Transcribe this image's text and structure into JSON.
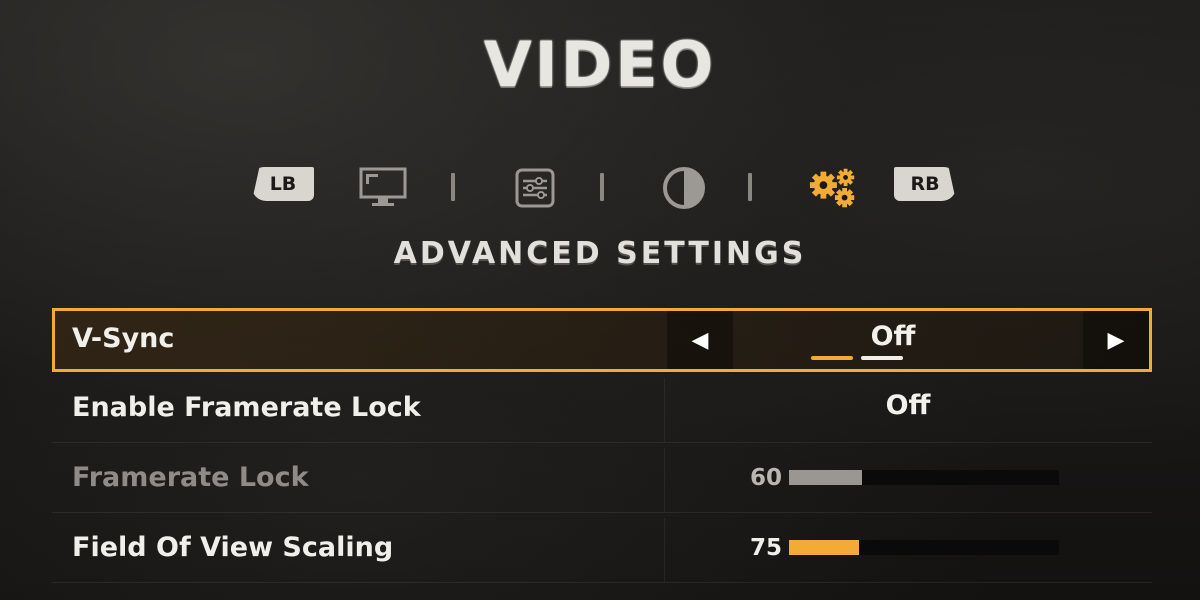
{
  "header": {
    "title": "VIDEO"
  },
  "tabs": {
    "left_bumper": "LB",
    "right_bumper": "RB",
    "items": [
      {
        "icon": "monitor-icon",
        "active": false
      },
      {
        "icon": "sliders-icon",
        "active": false
      },
      {
        "icon": "contrast-icon",
        "active": false
      },
      {
        "icon": "gears-icon",
        "active": true
      }
    ]
  },
  "section": {
    "title": "ADVANCED SETTINGS"
  },
  "colors": {
    "accent": "#f2ab34",
    "inactive_fill": "#9a9792",
    "text": "#f1efea"
  },
  "settings": [
    {
      "label": "V-Sync",
      "value": "Off",
      "type": "selector",
      "options_count": 2,
      "selected_index": 0
    },
    {
      "label": "Enable Framerate Lock",
      "value": "Off",
      "type": "selector"
    },
    {
      "label": "Framerate Lock",
      "value": "60",
      "type": "slider",
      "fill_fraction": 0.27,
      "enabled": false
    },
    {
      "label": "Field Of View Scaling",
      "value": "75",
      "type": "slider",
      "fill_fraction": 0.26,
      "enabled": true
    }
  ]
}
